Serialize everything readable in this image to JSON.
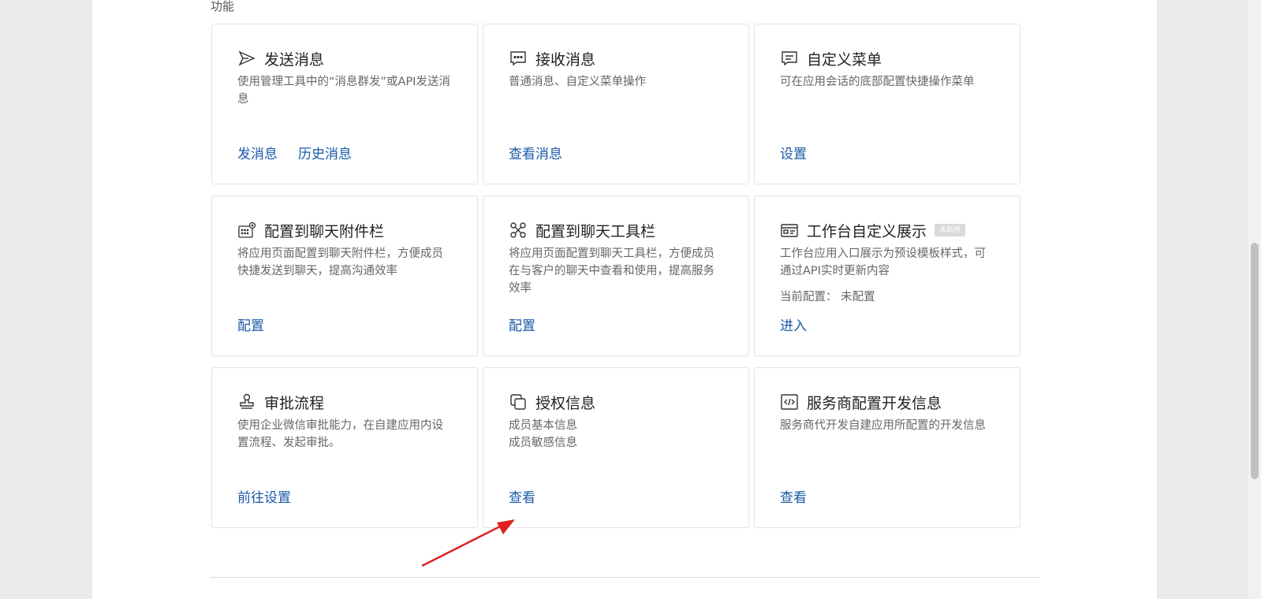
{
  "section": {
    "title": "功能"
  },
  "cards": [
    {
      "title": "发送消息",
      "icon": "send-icon",
      "desc": "使用管理工具中的“消息群发”或API发送消息",
      "links": [
        "发消息",
        "历史消息"
      ]
    },
    {
      "title": "接收消息",
      "icon": "message-icon",
      "desc": "普通消息、自定义菜单操作",
      "links": [
        "查看消息"
      ]
    },
    {
      "title": "自定义菜单",
      "icon": "menu-icon",
      "desc": "可在应用会话的底部配置快捷操作菜单",
      "links": [
        "设置"
      ]
    },
    {
      "title": "配置到聊天附件栏",
      "icon": "attachment-bar-icon",
      "desc": "将应用页面配置到聊天附件栏，方便成员快捷发送到聊天，提高沟通效率",
      "links": [
        "配置"
      ]
    },
    {
      "title": "配置到聊天工具栏",
      "icon": "toolbar-icon",
      "desc": "将应用页面配置到聊天工具栏，方便成员在与客户的聊天中查看和使用，提高服务效率",
      "links": [
        "配置"
      ]
    },
    {
      "title": "工作台自定义展示",
      "icon": "workbench-icon",
      "badge": "未启用",
      "desc": "工作台应用入口展示为预设模板样式，可通过API实时更新内容",
      "extra": "当前配置： 未配置",
      "links": [
        "进入"
      ]
    },
    {
      "title": "审批流程",
      "icon": "stamp-icon",
      "desc": "使用企业微信审批能力，在自建应用内设置流程、发起审批。",
      "links": [
        "前往设置"
      ]
    },
    {
      "title": "授权信息",
      "icon": "authorization-icon",
      "desc_lines": [
        "成员基本信息",
        "成员敏感信息"
      ],
      "links": [
        "查看"
      ]
    },
    {
      "title": "服务商配置开发信息",
      "icon": "code-icon",
      "desc": "服务商代开发自建应用所配置的开发信息",
      "links": [
        "查看"
      ]
    }
  ],
  "colors": {
    "link": "#1a5aa8",
    "annotation_arrow": "#e02020"
  }
}
